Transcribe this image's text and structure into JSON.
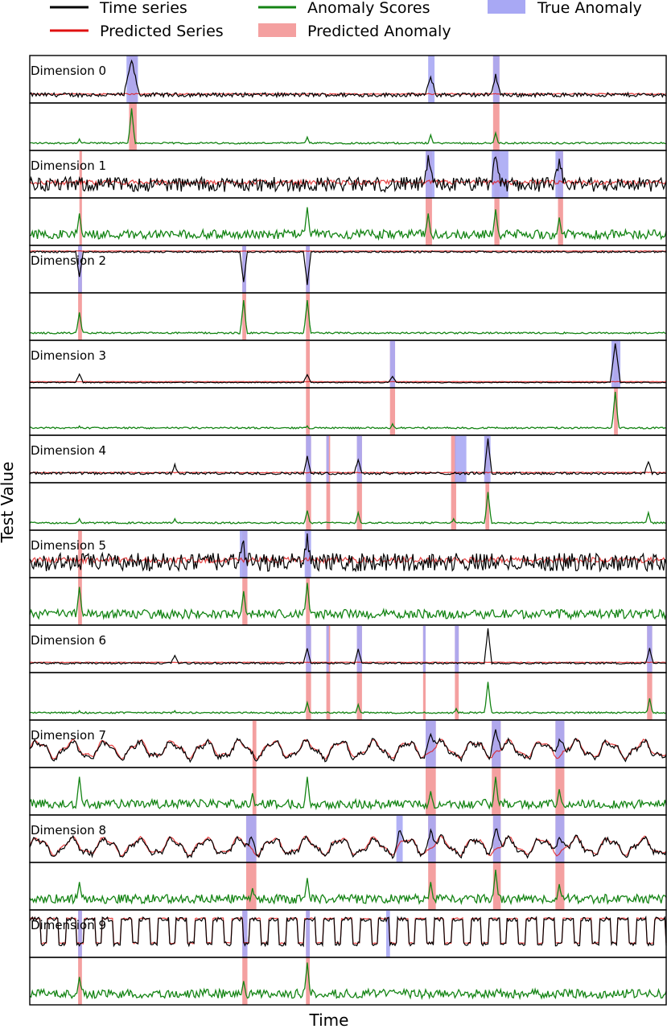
{
  "legend": {
    "time_series": "Time series",
    "predicted_series": "Predicted Series",
    "anomaly_scores": "Anomaly Scores",
    "predicted_anomaly": "Predicted Anomaly",
    "true_anomaly": "True Anomaly"
  },
  "colors": {
    "time_series": "#000000",
    "predicted_series": "#e01010",
    "anomaly_scores": "#148414",
    "predicted_anomaly": "#f4a0a0",
    "true_anomaly": "#a8a8f4"
  },
  "axes": {
    "xlabel": "Time",
    "ylabel": "Test Value"
  },
  "chart_data": {
    "type": "line",
    "x_range": [
      0,
      500
    ],
    "xlabel": "Time",
    "ylabel": "Test Value",
    "legend_position": "top",
    "series_names": [
      "Time series",
      "Predicted Series",
      "Anomaly Scores",
      "Predicted Anomaly",
      "True Anomaly"
    ],
    "dimensions": [
      {
        "label": "Dimension 0",
        "style": "flat",
        "baseline": 0.12,
        "noise": 0.05,
        "spikes": [
          {
            "t": 80,
            "h": 0.85,
            "w": 5
          },
          {
            "t": 315,
            "h": 0.45,
            "w": 3
          },
          {
            "t": 366,
            "h": 0.48,
            "w": 3
          }
        ],
        "true_anomalies": [
          [
            76,
            85
          ],
          [
            313,
            318
          ],
          [
            364,
            369
          ]
        ],
        "predicted_anomalies": [
          [
            78,
            84
          ],
          [
            364,
            369
          ]
        ],
        "score_spikes": [
          {
            "t": 39,
            "h": 0.2
          },
          {
            "t": 80,
            "h": 0.95
          },
          {
            "t": 218,
            "h": 0.25
          },
          {
            "t": 315,
            "h": 0.3
          },
          {
            "t": 366,
            "h": 0.35
          }
        ]
      },
      {
        "label": "Dimension 1",
        "style": "noisy",
        "baseline": 0.25,
        "noise": 0.18,
        "spikes": [
          {
            "t": 313,
            "h": 0.55,
            "w": 3
          },
          {
            "t": 366,
            "h": 0.75,
            "w": 3
          },
          {
            "t": 416,
            "h": 0.45,
            "w": 3
          }
        ],
        "true_anomalies": [
          [
            311,
            318
          ],
          [
            363,
            376
          ],
          [
            413,
            419
          ]
        ],
        "predicted_anomalies": [
          [
            39,
            41
          ],
          [
            311,
            316
          ],
          [
            365,
            369
          ],
          [
            415,
            419
          ]
        ],
        "score_spikes": [
          {
            "t": 39,
            "h": 0.7
          },
          {
            "t": 218,
            "h": 0.85
          },
          {
            "t": 313,
            "h": 0.7
          },
          {
            "t": 366,
            "h": 0.8
          },
          {
            "t": 416,
            "h": 0.6
          }
        ]
      },
      {
        "label": "Dimension 2",
        "style": "top",
        "baseline": 0.92,
        "noise": 0.02,
        "spikes": [
          {
            "t": 39,
            "h": -0.6,
            "w": 2
          },
          {
            "t": 168,
            "h": -0.75,
            "w": 2
          },
          {
            "t": 218,
            "h": -0.8,
            "w": 2
          }
        ],
        "true_anomalies": [
          [
            38,
            41
          ],
          [
            167,
            170
          ],
          [
            217,
            220
          ]
        ],
        "predicted_anomalies": [
          [
            38,
            41
          ],
          [
            167,
            170
          ],
          [
            217,
            220
          ]
        ],
        "score_spikes": [
          {
            "t": 39,
            "h": 0.6
          },
          {
            "t": 168,
            "h": 0.9
          },
          {
            "t": 218,
            "h": 0.9
          }
        ]
      },
      {
        "label": "Dimension 3",
        "style": "flat",
        "baseline": 0.05,
        "noise": 0.01,
        "spikes": [
          {
            "t": 39,
            "h": 0.2,
            "w": 2
          },
          {
            "t": 218,
            "h": 0.2,
            "w": 2
          },
          {
            "t": 285,
            "h": 0.15,
            "w": 2
          },
          {
            "t": 460,
            "h": 0.95,
            "w": 3
          }
        ],
        "true_anomalies": [
          [
            283,
            287
          ],
          [
            457,
            464
          ]
        ],
        "predicted_anomalies": [
          [
            217,
            220
          ],
          [
            283,
            287
          ],
          [
            459,
            462
          ]
        ],
        "score_spikes": [
          {
            "t": 39,
            "h": 0.15
          },
          {
            "t": 218,
            "h": 0.15
          },
          {
            "t": 285,
            "h": 0.2
          },
          {
            "t": 460,
            "h": 0.98
          }
        ]
      },
      {
        "label": "Dimension 4",
        "style": "flat",
        "baseline": 0.15,
        "noise": 0.03,
        "spikes": [
          {
            "t": 114,
            "h": 0.2,
            "w": 2
          },
          {
            "t": 218,
            "h": 0.4,
            "w": 2
          },
          {
            "t": 258,
            "h": 0.35,
            "w": 2
          },
          {
            "t": 360,
            "h": 0.85,
            "w": 2
          },
          {
            "t": 486,
            "h": 0.3,
            "w": 2
          }
        ],
        "true_anomalies": [
          [
            217,
            221
          ],
          [
            233,
            235
          ],
          [
            257,
            261
          ],
          [
            334,
            343
          ],
          [
            357,
            362
          ]
        ],
        "predicted_anomalies": [
          [
            217,
            221
          ],
          [
            233,
            236
          ],
          [
            257,
            261
          ],
          [
            331,
            335
          ],
          [
            358,
            361
          ]
        ],
        "score_spikes": [
          {
            "t": 39,
            "h": 0.2
          },
          {
            "t": 114,
            "h": 0.2
          },
          {
            "t": 218,
            "h": 0.4
          },
          {
            "t": 258,
            "h": 0.35
          },
          {
            "t": 333,
            "h": 0.2
          },
          {
            "t": 360,
            "h": 0.85
          },
          {
            "t": 486,
            "h": 0.35
          }
        ]
      },
      {
        "label": "Dimension 5",
        "style": "noisy",
        "baseline": 0.3,
        "noise": 0.22,
        "spikes": [
          {
            "t": 168,
            "h": 0.35,
            "w": 3
          },
          {
            "t": 218,
            "h": 0.6,
            "w": 3
          }
        ],
        "true_anomalies": [
          [
            165,
            171
          ],
          [
            216,
            221
          ]
        ],
        "predicted_anomalies": [
          [
            38,
            41
          ],
          [
            167,
            171
          ],
          [
            217,
            220
          ]
        ],
        "score_spikes": [
          {
            "t": 39,
            "h": 0.85
          },
          {
            "t": 168,
            "h": 0.75
          },
          {
            "t": 218,
            "h": 0.95
          }
        ]
      },
      {
        "label": "Dimension 6",
        "style": "flat",
        "baseline": 0.15,
        "noise": 0.02,
        "spikes": [
          {
            "t": 114,
            "h": 0.2,
            "w": 2
          },
          {
            "t": 218,
            "h": 0.35,
            "w": 2
          },
          {
            "t": 258,
            "h": 0.35,
            "w": 2
          },
          {
            "t": 360,
            "h": 0.85,
            "w": 2
          },
          {
            "t": 487,
            "h": 0.35,
            "w": 2
          }
        ],
        "true_anomalies": [
          [
            217,
            221
          ],
          [
            233,
            235
          ],
          [
            257,
            261
          ],
          [
            309,
            311
          ],
          [
            334,
            337
          ],
          [
            485,
            489
          ]
        ],
        "predicted_anomalies": [
          [
            217,
            221
          ],
          [
            233,
            236
          ],
          [
            257,
            261
          ],
          [
            309,
            311
          ],
          [
            334,
            337
          ],
          [
            485,
            489
          ]
        ],
        "score_spikes": [
          {
            "t": 39,
            "h": 0.15
          },
          {
            "t": 114,
            "h": 0.15
          },
          {
            "t": 218,
            "h": 0.35
          },
          {
            "t": 258,
            "h": 0.3
          },
          {
            "t": 335,
            "h": 0.2
          },
          {
            "t": 360,
            "h": 0.85
          },
          {
            "t": 487,
            "h": 0.45
          }
        ]
      },
      {
        "label": "Dimension 7",
        "style": "periodic",
        "baseline": 0.35,
        "noise": 0.06,
        "spikes": [
          {
            "t": 315,
            "h": 0.45,
            "w": 4
          },
          {
            "t": 366,
            "h": 0.55,
            "w": 4
          },
          {
            "t": 416,
            "h": 0.45,
            "w": 4
          }
        ],
        "true_anomalies": [
          [
            311,
            319
          ],
          [
            363,
            370
          ],
          [
            413,
            420
          ]
        ],
        "predicted_anomalies": [
          [
            175,
            178
          ],
          [
            311,
            319
          ],
          [
            363,
            370
          ],
          [
            413,
            420
          ]
        ],
        "score_spikes": [
          {
            "t": 39,
            "h": 0.85
          },
          {
            "t": 175,
            "h": 0.45
          },
          {
            "t": 218,
            "h": 0.85
          },
          {
            "t": 315,
            "h": 0.5
          },
          {
            "t": 366,
            "h": 0.85
          },
          {
            "t": 416,
            "h": 0.55
          }
        ]
      },
      {
        "label": "Dimension 8",
        "style": "periodic",
        "baseline": 0.3,
        "noise": 0.06,
        "spikes": [
          {
            "t": 175,
            "h": 0.3,
            "w": 3
          },
          {
            "t": 290,
            "h": 0.35,
            "w": 3
          },
          {
            "t": 315,
            "h": 0.45,
            "w": 4
          },
          {
            "t": 366,
            "h": 0.55,
            "w": 4
          },
          {
            "t": 416,
            "h": 0.45,
            "w": 4
          }
        ],
        "true_anomalies": [
          [
            170,
            178
          ],
          [
            288,
            293
          ],
          [
            313,
            319
          ],
          [
            364,
            370
          ],
          [
            413,
            420
          ]
        ],
        "predicted_anomalies": [
          [
            170,
            178
          ],
          [
            313,
            319
          ],
          [
            364,
            370
          ],
          [
            413,
            420
          ]
        ],
        "score_spikes": [
          {
            "t": 39,
            "h": 0.6
          },
          {
            "t": 175,
            "h": 0.45
          },
          {
            "t": 218,
            "h": 0.7
          },
          {
            "t": 315,
            "h": 0.6
          },
          {
            "t": 366,
            "h": 0.9
          },
          {
            "t": 416,
            "h": 0.55
          }
        ]
      },
      {
        "label": "Dimension 9",
        "style": "square",
        "baseline": 0.85,
        "noise": 0.05,
        "spikes": [],
        "true_anomalies": [
          [
            38,
            41
          ],
          [
            167,
            171
          ],
          [
            217,
            220
          ],
          [
            280,
            283
          ]
        ],
        "predicted_anomalies": [
          [
            38,
            41
          ],
          [
            167,
            171
          ],
          [
            217,
            220
          ]
        ],
        "score_spikes": [
          {
            "t": 39,
            "h": 0.6
          },
          {
            "t": 168,
            "h": 0.5
          },
          {
            "t": 218,
            "h": 0.95
          }
        ]
      }
    ]
  }
}
